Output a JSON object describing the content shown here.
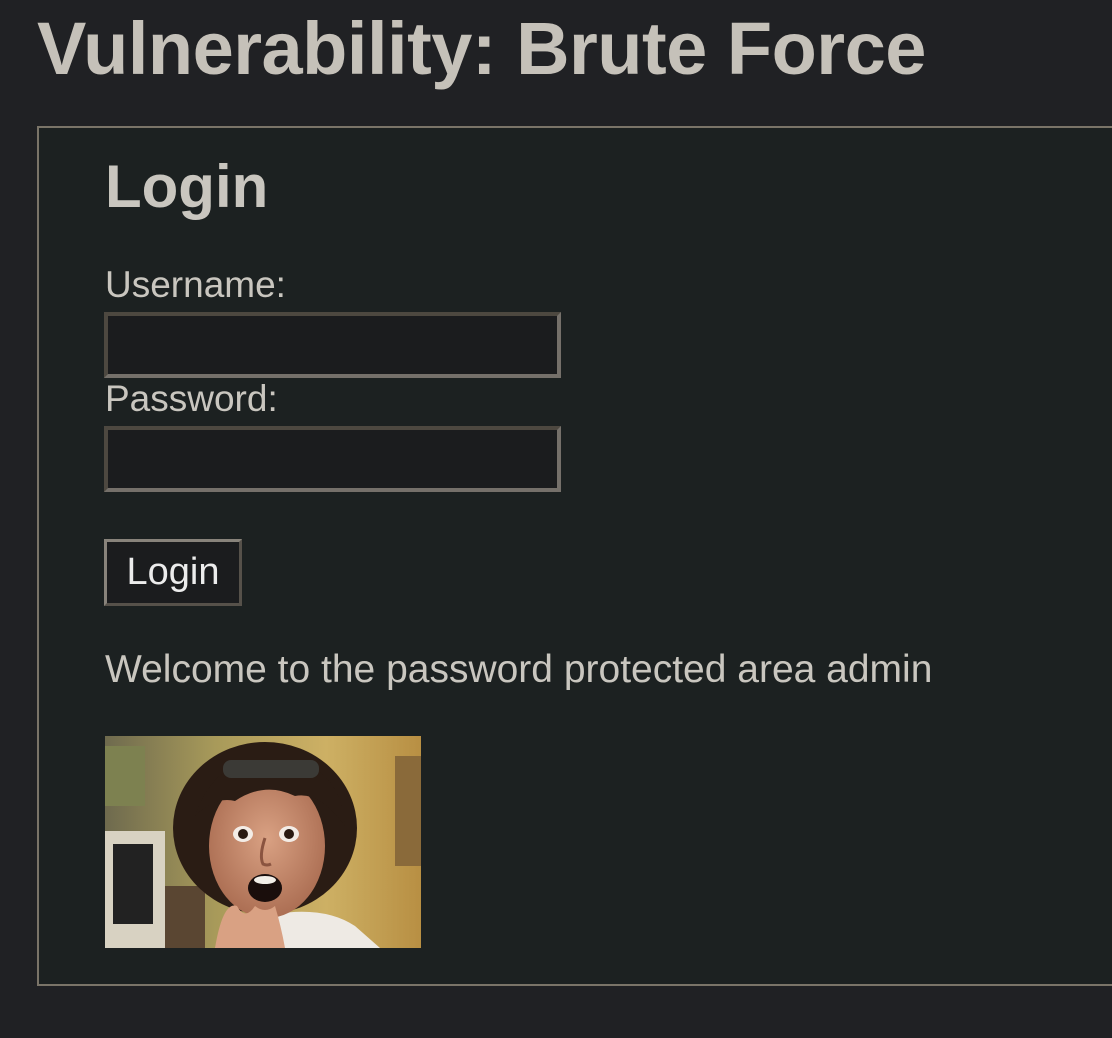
{
  "page": {
    "title": "Vulnerability: Brute Force"
  },
  "login_form": {
    "heading": "Login",
    "username_label": "Username:",
    "username_value": "",
    "password_label": "Password:",
    "password_value": "",
    "submit_label": "Login"
  },
  "result": {
    "message": "Welcome to the password protected area admin",
    "image_subject": "surprised-user-photo"
  }
}
